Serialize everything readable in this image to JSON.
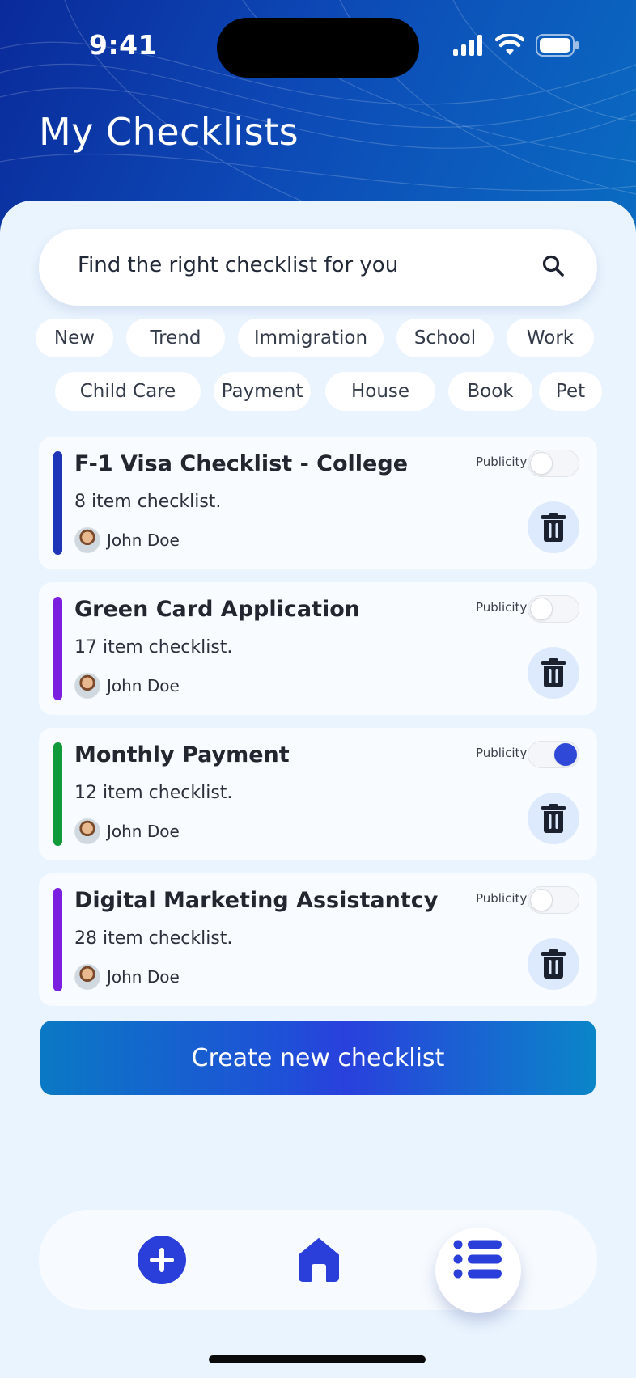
{
  "status": {
    "time": "9:41"
  },
  "header": {
    "title": "My Checklists"
  },
  "search": {
    "placeholder": "Find the right checklist for you"
  },
  "chips_row1": [
    "New",
    "Trend",
    "Immigration",
    "School",
    "Work"
  ],
  "chips_row2": [
    "Child Care",
    "Payment",
    "House",
    "Book",
    "Pet"
  ],
  "checklists": [
    {
      "title": "F-1 Visa Checklist - College",
      "subtitle": "8 item checklist.",
      "author": "John Doe",
      "publicity_label": "Publicity",
      "public": false,
      "color": "#1f35b8"
    },
    {
      "title": "Green Card Application",
      "subtitle": "17 item checklist.",
      "author": "John Doe",
      "publicity_label": "Publicity",
      "public": false,
      "color": "#7a1fe0"
    },
    {
      "title": "Monthly Payment",
      "subtitle": "12 item checklist.",
      "author": "John Doe",
      "publicity_label": "Publicity",
      "public": true,
      "color": "#119a3a"
    },
    {
      "title": "Digital Marketing Assistantcy",
      "subtitle": "28 item checklist.",
      "author": "John Doe",
      "publicity_label": "Publicity",
      "public": false,
      "color": "#7a1fe0"
    }
  ],
  "actions": {
    "create_label": "Create new checklist"
  },
  "nav": {
    "items": [
      "plus-icon",
      "home-icon",
      "list-icon"
    ],
    "active": "list-icon"
  },
  "colors": {
    "accent": "#2a3fd9",
    "header": "#0d49b6"
  }
}
